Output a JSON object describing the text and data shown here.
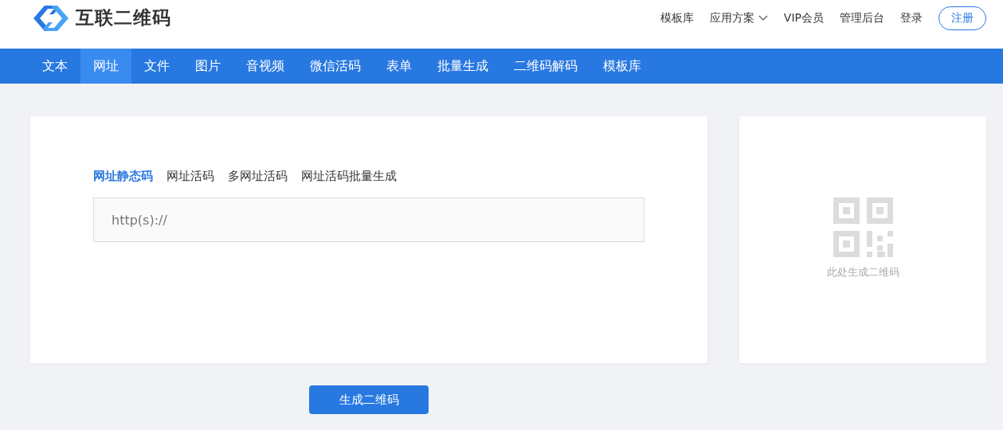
{
  "logo": {
    "text": "互联二维码"
  },
  "top_menu": [
    {
      "label": "模板库",
      "dropdown": false
    },
    {
      "label": "应用方案",
      "dropdown": true
    },
    {
      "label": "VIP会员",
      "dropdown": false
    },
    {
      "label": "管理后台",
      "dropdown": false
    },
    {
      "label": "登录",
      "dropdown": false
    }
  ],
  "register_button": "注册",
  "nav_tabs": [
    {
      "label": "文本",
      "selected": false
    },
    {
      "label": "网址",
      "selected": true
    },
    {
      "label": "文件",
      "selected": false
    },
    {
      "label": "图片",
      "selected": false
    },
    {
      "label": "音视频",
      "selected": false
    },
    {
      "label": "微信活码",
      "selected": false
    },
    {
      "label": "表单",
      "selected": false
    },
    {
      "label": "批量生成",
      "selected": false
    },
    {
      "label": "二维码解码",
      "selected": false
    },
    {
      "label": "模板库",
      "selected": false
    }
  ],
  "sub_tabs": [
    {
      "label": "网址静态码",
      "selected": true
    },
    {
      "label": "网址活码",
      "selected": false
    },
    {
      "label": "多网址活码",
      "selected": false
    },
    {
      "label": "网址活码批量生成",
      "selected": false
    }
  ],
  "url_field": {
    "placeholder": "http(s)://"
  },
  "preview": {
    "caption": "此处生成二维码"
  },
  "generate_button": "生成二维码"
}
